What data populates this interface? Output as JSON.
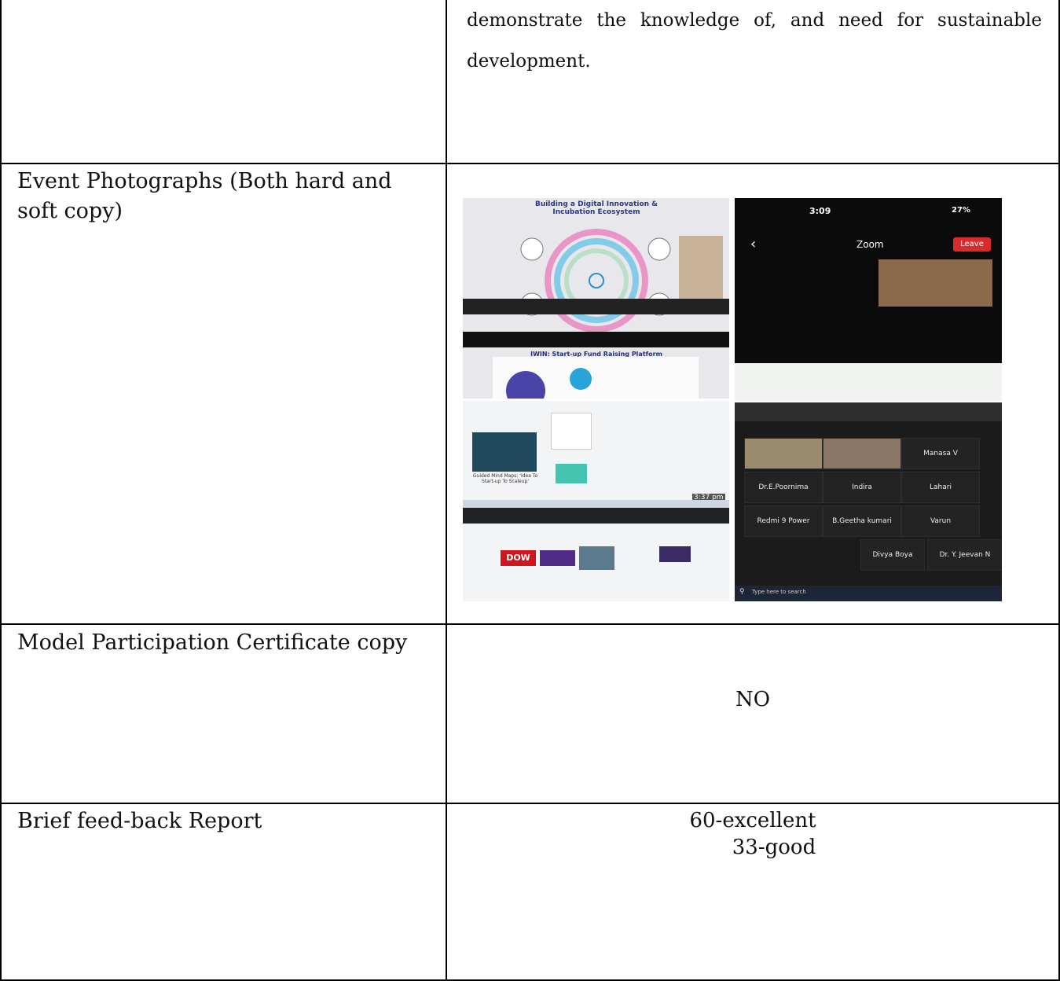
{
  "rows": [
    {
      "label": "",
      "content": "demonstrate the knowledge of, and need for sustainable development."
    },
    {
      "label": "Event Photographs (Both hard and soft copy)",
      "content": ""
    },
    {
      "label": "Model Participation Certificate copy",
      "content": "NO"
    },
    {
      "label": "Brief feed-back Report",
      "content_lines": [
        "60-excellent",
        "33-good"
      ]
    }
  ],
  "photos": {
    "slide_title": "Building a Digital Innovation & Incubation Ecosystem",
    "slide2_title": "IWIN: Start-up Fund Raising Platform",
    "phone_status_time": "3:09",
    "phone_battery": "27%",
    "zoom_label": "Zoom",
    "leave_label": "Leave",
    "mindmap_caption": "Guided Mind Maps: 'Idea To Start-up To Scaleup'",
    "participants": [
      "Manasa V",
      "Dr.E.Poornima",
      "Indira",
      "Lahari",
      "Redmi 9 Power",
      "B.Geetha kumari",
      "Varun",
      "Divya Boya",
      "Dr. Y. Jeevan N"
    ],
    "search_placeholder": "Type here to search",
    "brand_tile": "DOW",
    "video_time": "3:37 pm"
  }
}
